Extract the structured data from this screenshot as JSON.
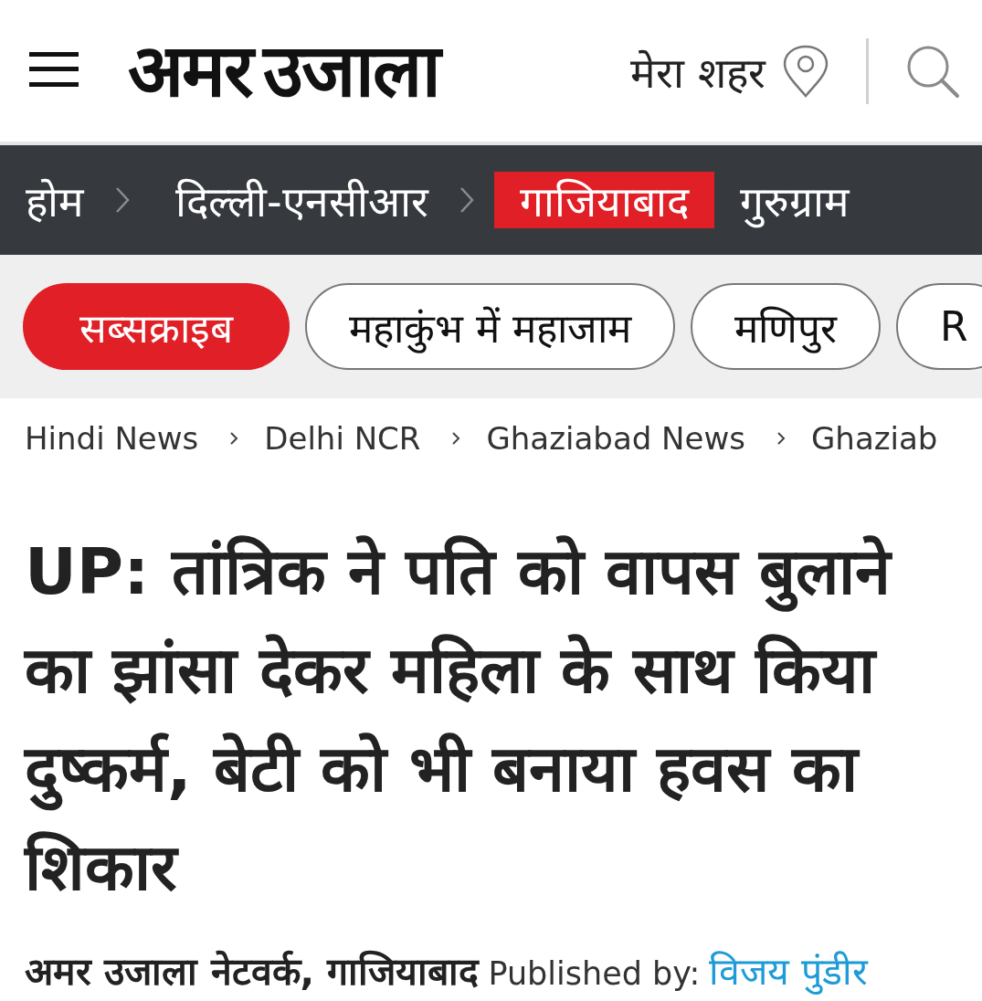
{
  "header": {
    "logo": "अमर उजाला",
    "city_label": "मेरा शहर"
  },
  "nav": [
    {
      "label": "होम",
      "selected": false,
      "chevron": true
    },
    {
      "label": "दिल्ली-एनसीआर",
      "selected": false,
      "chevron": true
    },
    {
      "label": "गाजियाबाद",
      "selected": true,
      "chevron": false
    },
    {
      "label": "गुरुग्राम",
      "selected": false,
      "chevron": false
    }
  ],
  "topics": [
    {
      "label": "सब्सक्राइब",
      "kind": "subscribe"
    },
    {
      "label": "महाकुंभ में महाजाम",
      "kind": "topic"
    },
    {
      "label": "मणिपुर",
      "kind": "topic"
    },
    {
      "label": "R",
      "kind": "topic"
    }
  ],
  "breadcrumb": [
    "Hindi News",
    "Delhi NCR",
    "Ghaziabad News",
    "Ghaziab"
  ],
  "headline": "UP: तांत्रिक ने पति को वापस बुलाने का झांसा देकर महिला के साथ किया दुष्कर्म, बेटी को भी बनाया हवस का शिकार",
  "byline": {
    "source": "अमर उजाला नेटवर्क, गाजियाबाद",
    "published_label": "Published by:",
    "author": "विजय पुंडीर"
  }
}
